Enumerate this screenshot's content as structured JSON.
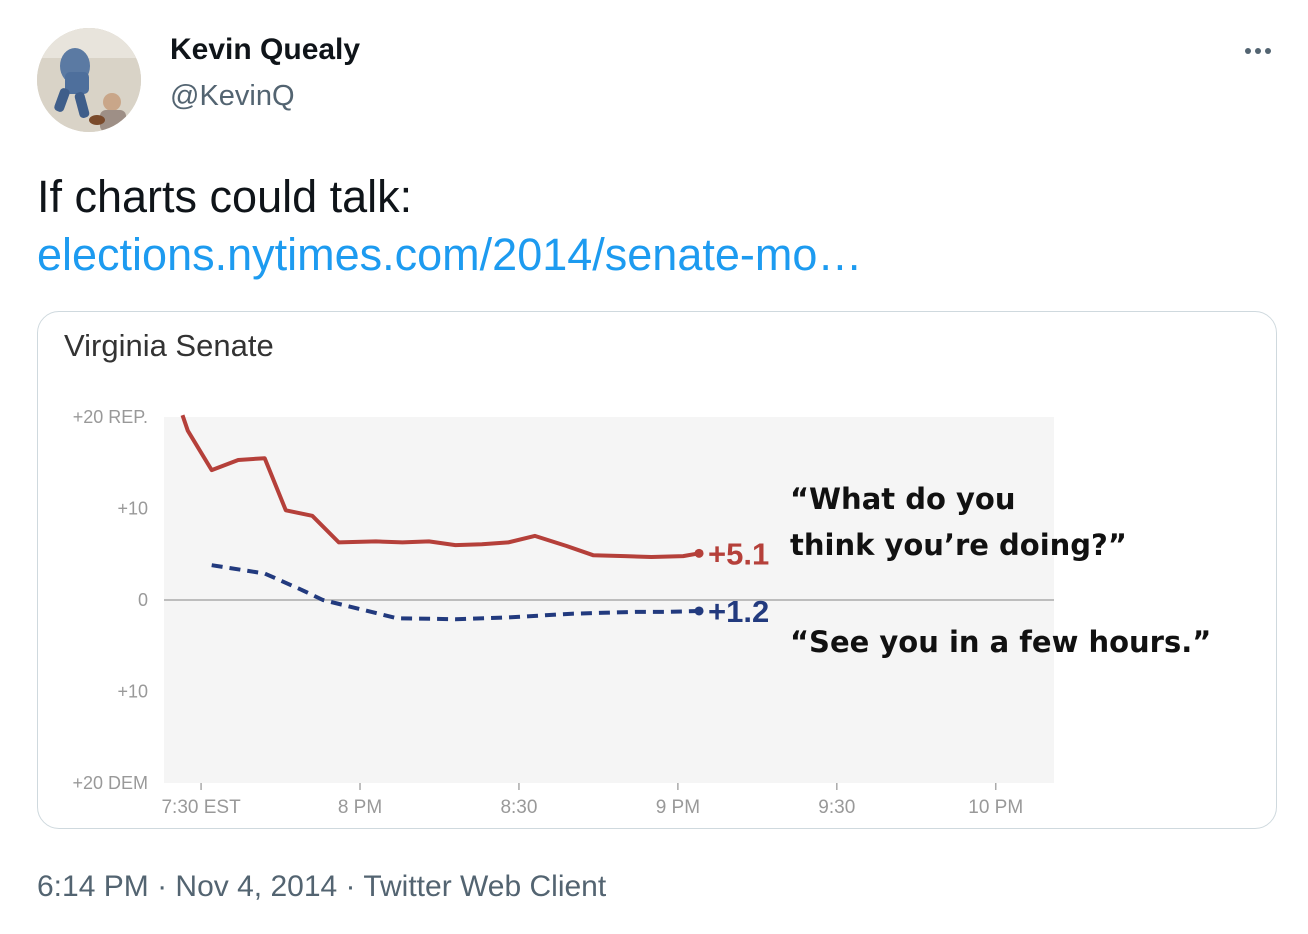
{
  "tweet": {
    "author_name": "Kevin Quealy",
    "handle": "@KevinQ",
    "text": "If charts could talk:",
    "link_text": "elections.nytimes.com/2014/senate-mo…",
    "time": "6:14 PM",
    "date": "Nov 4, 2014",
    "client": "Twitter Web Client",
    "separator": "·",
    "more_icon": "more-horizontal-icon"
  },
  "chart_data": {
    "type": "line",
    "title": "Virginia Senate",
    "x_ticks": [
      "7:30 EST",
      "8 PM",
      "8:30",
      "9 PM",
      "9:30",
      "10 PM"
    ],
    "x_tick_minutes": [
      0,
      30,
      60,
      90,
      120,
      150
    ],
    "xlim": [
      -7,
      161
    ],
    "y_ticks": [
      {
        "value": 20,
        "label": "+20 REP."
      },
      {
        "value": 10,
        "label": "+10"
      },
      {
        "value": 0,
        "label": "0"
      },
      {
        "value": -10,
        "label": "+10"
      },
      {
        "value": -20,
        "label": "+20 DEM"
      }
    ],
    "ylim": [
      -20,
      20
    ],
    "grid": false,
    "series": [
      {
        "color": "#b5403a",
        "style": "solid",
        "end_label": "+5.1",
        "x": [
          -3.5,
          -2.5,
          2,
          7,
          12,
          16,
          21,
          26,
          33,
          38,
          43,
          48,
          53,
          58,
          63,
          69,
          74,
          80,
          85,
          91,
          94
        ],
        "y": [
          20.2,
          18.5,
          14.2,
          15.3,
          15.5,
          9.8,
          9.2,
          6.3,
          6.4,
          6.3,
          6.4,
          6.0,
          6.1,
          6.3,
          7.0,
          5.9,
          4.9,
          4.8,
          4.7,
          4.8,
          5.1
        ]
      },
      {
        "color": "#223a7e",
        "style": "dashed",
        "end_label": "+1.2",
        "x": [
          2,
          12,
          19,
          23,
          30,
          37,
          48,
          58,
          64,
          70,
          76,
          82,
          88,
          94
        ],
        "y": [
          3.8,
          2.9,
          1.1,
          0.0,
          -1.0,
          -2.0,
          -2.1,
          -1.9,
          -1.7,
          -1.5,
          -1.4,
          -1.3,
          -1.3,
          -1.2
        ]
      }
    ],
    "annotations": [
      {
        "text": "“What do you",
        "target": "+5.1"
      },
      {
        "text": "think you’re doing?”",
        "target": "+5.1"
      },
      {
        "text": "“See you in a few hours.”",
        "target": "+1.2"
      }
    ]
  }
}
